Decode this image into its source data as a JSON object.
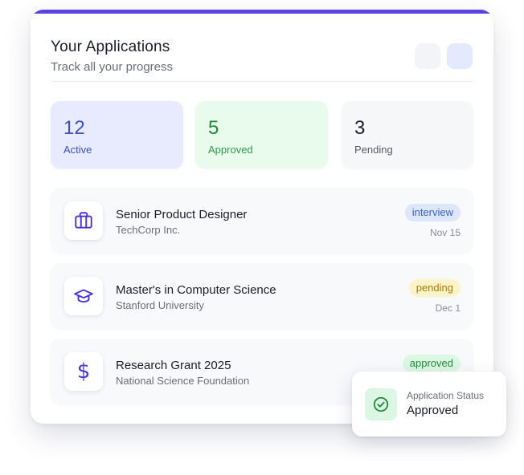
{
  "header": {
    "title": "Your Applications",
    "subtitle": "Track all your progress"
  },
  "colors": {
    "accent": "#5b45e0",
    "icon": "#4a36d6",
    "active": "#3d4fbf",
    "approved": "#1f8a3a",
    "pending": "#a57a11"
  },
  "stats": [
    {
      "value": "12",
      "label": "Active"
    },
    {
      "value": "5",
      "label": "Approved"
    },
    {
      "value": "3",
      "label": "Pending"
    }
  ],
  "applications": [
    {
      "icon": "briefcase-icon",
      "title": "Senior Product Designer",
      "subtitle": "TechCorp Inc.",
      "status": "interview",
      "date": "Nov 15"
    },
    {
      "icon": "graduation-cap-icon",
      "title": "Master's in Computer Science",
      "subtitle": "Stanford University",
      "status": "pending",
      "date": "Dec 1"
    },
    {
      "icon": "dollar-icon",
      "title": "Research Grant 2025",
      "subtitle": "National Science Foundation",
      "status": "approved"
    }
  ],
  "toast": {
    "icon": "check-circle-icon",
    "label": "Application Status",
    "value": "Approved"
  }
}
